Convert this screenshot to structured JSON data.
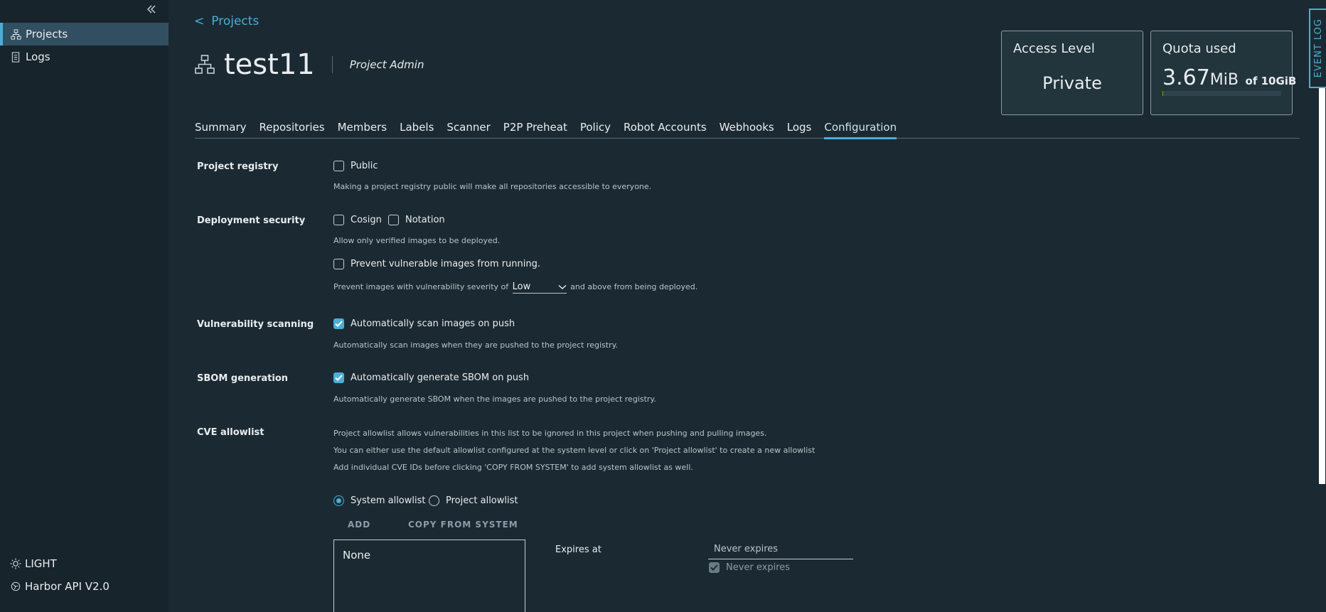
{
  "sidebar": {
    "items": [
      {
        "label": "Projects",
        "icon": "projects-icon",
        "active": true
      },
      {
        "label": "Logs",
        "icon": "logs-icon",
        "active": false
      }
    ],
    "theme_toggle": "LIGHT",
    "api_link": "Harbor API V2.0"
  },
  "header": {
    "back_label": "Projects",
    "project_name": "test11",
    "role": "Project Admin"
  },
  "cards": {
    "access": {
      "title": "Access Level",
      "value": "Private"
    },
    "quota": {
      "title": "Quota used",
      "used": "3.67",
      "unit": "MiB",
      "limit": "of 10GiB"
    }
  },
  "event_log": "EVENT LOG",
  "tabs": [
    "Summary",
    "Repositories",
    "Members",
    "Labels",
    "Scanner",
    "P2P Preheat",
    "Policy",
    "Robot Accounts",
    "Webhooks",
    "Logs",
    "Configuration"
  ],
  "active_tab": "Configuration",
  "config": {
    "registry": {
      "label": "Project registry",
      "public_label": "Public",
      "public_checked": false,
      "help": "Making a project registry public will make all repositories accessible to everyone."
    },
    "deployment": {
      "label": "Deployment security",
      "cosign_label": "Cosign",
      "notation_label": "Notation",
      "help": "Allow only verified images to be deployed.",
      "prevent_label": "Prevent vulnerable images from running.",
      "severity_prefix": "Prevent images with vulnerability severity of",
      "severity_value": "Low",
      "severity_suffix": "and above from being deployed."
    },
    "scanning": {
      "label": "Vulnerability scanning",
      "auto_scan_label": "Automatically scan images on push",
      "auto_scan_checked": true,
      "help": "Automatically scan images when they are pushed to the project registry."
    },
    "sbom": {
      "label": "SBOM generation",
      "auto_sbom_label": "Automatically generate SBOM on push",
      "auto_sbom_checked": true,
      "help": "Automatically generate SBOM when the images are pushed to the project registry."
    },
    "cve": {
      "label": "CVE allowlist",
      "help1": "Project allowlist allows vulnerabilities in this list to be ignored in this project when pushing and pulling images.",
      "help2": "You can either use the default allowlist configured at the system level or click on 'Project allowlist' to create a new allowlist",
      "help3": "Add individual CVE IDs before clicking 'COPY FROM SYSTEM' to add system allowlist as well.",
      "system_label": "System allowlist",
      "project_label": "Project allowlist",
      "selected": "system",
      "add_button": "ADD",
      "copy_button": "COPY FROM SYSTEM",
      "list_value": "None",
      "expires_label": "Expires at",
      "expires_value": "Never expires",
      "never_expires_label": "Never expires"
    }
  },
  "colors": {
    "background": "#1b2a32",
    "sidebar": "#17242b",
    "accent": "#49afd9",
    "quota_fill": "#60b515"
  }
}
